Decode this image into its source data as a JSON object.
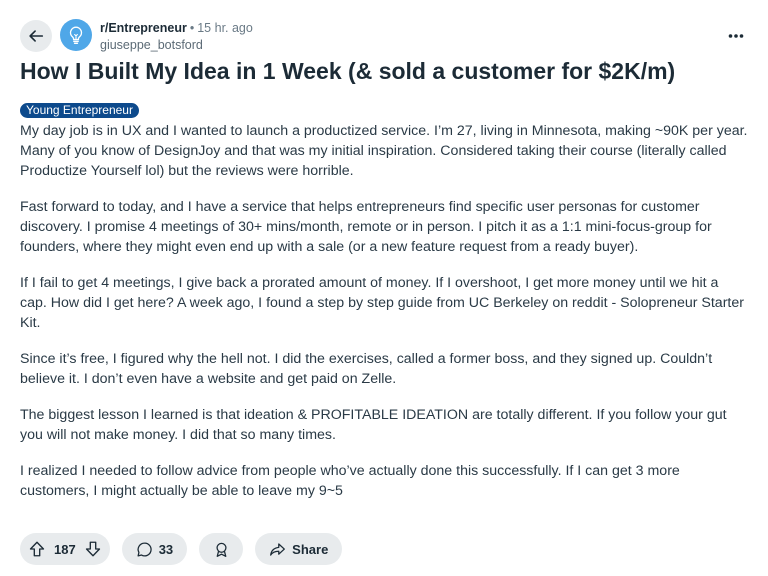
{
  "header": {
    "subreddit": "r/Entrepreneur",
    "separator": "•",
    "time": "15 hr. ago",
    "username": "giuseppe_botsford"
  },
  "post": {
    "title": "How I Built My Idea in 1 Week (& sold a customer for $2K/m)",
    "flair": "Young Entrepreneur",
    "paragraphs": [
      "My day job is in UX and I wanted to launch a productized service. I’m 27, living in Minnesota, making ~90K per year. Many of you know of DesignJoy and that was my initial inspiration. Considered taking their course (literally called Productize Yourself lol) but the reviews were horrible.",
      "Fast forward to today, and I have a service that helps entrepreneurs find specific user personas for customer discovery. I promise 4 meetings of 30+ mins/month, remote or in person. I pitch it as a 1:1 mini-focus-group for founders, where they might even end up with a sale (or a new feature request from a ready buyer).",
      "If I fail to get 4 meetings, I give back a prorated amount of money. If I overshoot, I get more money until we hit a cap. How did I get here? A week ago, I found a step by step guide from UC Berkeley on reddit - Solopreneur Starter Kit.",
      "Since it’s free, I figured why the hell not. I did the exercises, called a former boss, and they signed up. Couldn’t believe it. I don’t even have a website and get paid on Zelle.",
      "The biggest lesson I learned is that ideation & PROFITABLE IDEATION are totally different. If you follow your gut you will not make money. I did that so many times.",
      "I realized I needed to follow advice from people who’ve actually done this successfully. If I can get 3 more customers, I might actually be able to leave my 9~5"
    ]
  },
  "actions": {
    "vote_count": "187",
    "comment_count": "33",
    "share_label": "Share"
  },
  "colors": {
    "flair_bg": "#0d4a8c",
    "pill_bg": "#e8ebed",
    "avatar_bg": "#4fa7e8"
  }
}
